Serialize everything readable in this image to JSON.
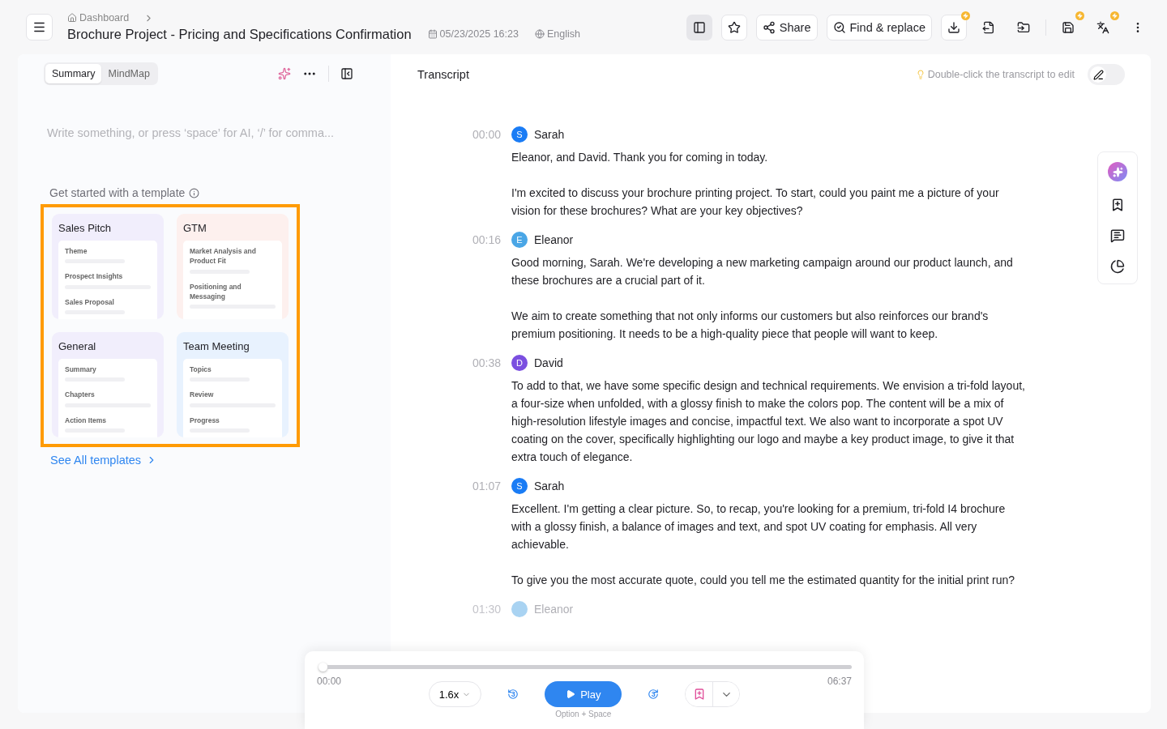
{
  "breadcrumb": "Dashboard",
  "title": "Brochure Project - Pricing and Specifications Confirmation",
  "date": "05/23/2025 16:23",
  "language": "English",
  "toolbar": [
    {
      "kind": "icon",
      "selected": true,
      "boosted": false
    },
    {
      "kind": "icon",
      "selected": false,
      "boosted": false
    },
    {
      "kind": "text",
      "label": "Share",
      "selected": false,
      "boosted": false
    },
    {
      "kind": "text",
      "label": "Find & replace",
      "selected": false,
      "boosted": false
    },
    {
      "kind": "icon",
      "selected": false,
      "boosted": true
    },
    {
      "kind": "plain",
      "selected": false,
      "boosted": false
    },
    {
      "kind": "plain",
      "selected": false,
      "boosted": false
    },
    {
      "kind": "plain",
      "selected": false,
      "boosted": true
    },
    {
      "kind": "plain",
      "selected": false,
      "boosted": true
    },
    {
      "kind": "plain",
      "selected": false,
      "boosted": false
    }
  ],
  "left_panel": {
    "tabs": [
      {
        "label": "Summary",
        "selected": true
      },
      {
        "label": "MindMap",
        "selected": false
      }
    ],
    "editor": {
      "placeholder": "Write something, or press ‘space’ for AI, ‘/’ for comma..."
    },
    "templates_heading": "Get started with a template",
    "templates": [
      {
        "title": "Sales Pitch",
        "color": "#f1eefc",
        "items": [
          "Theme",
          "Prospect Insights",
          "Sales Proposal"
        ]
      },
      {
        "title": "GTM",
        "color": "#fdf0ee",
        "items": [
          "Market Analysis and Product Fit",
          "Positioning and Messaging"
        ]
      },
      {
        "title": "General",
        "color": "#f1eefc",
        "items": [
          "Summary",
          "Chapters",
          "Action Items"
        ]
      },
      {
        "title": "Team Meeting",
        "color": "#e8f2fe",
        "items": [
          "Topics",
          "Review",
          "Progress"
        ]
      }
    ],
    "see_all": "See All templates"
  },
  "transcript": {
    "title": "Transcript",
    "hint": "Double-click the transcript to edit",
    "edit_toggle": {
      "on": false
    },
    "entries": [
      {
        "time": "00:00",
        "initial": "S",
        "speaker": "Sarah",
        "color": "#1a7cf5",
        "faded": false,
        "paragraphs": [
          "Eleanor, and David. Thank you for coming in today.",
          "I'm excited to discuss your brochure printing project. To start, could you paint me a picture of your vision for these brochures? What are your key objectives?"
        ]
      },
      {
        "time": "00:16",
        "initial": "E",
        "speaker": "Eleanor",
        "color": "#4aa6e6",
        "faded": false,
        "paragraphs": [
          "Good morning, Sarah. We're developing a new marketing campaign around our product launch, and these brochures are a crucial part of it.",
          "We aim to create something that not only informs our customers but also reinforces our brand's premium positioning. It needs to be a high-quality piece that people will want to keep."
        ]
      },
      {
        "time": "00:38",
        "initial": "D",
        "speaker": "David",
        "color": "#7b4fe0",
        "faded": false,
        "paragraphs": [
          "To add to that, we have some specific design and technical requirements. We envision a tri-fold layout, a four-size when unfolded, with a glossy finish to make the colors pop. The content will be a mix of high-resolution lifestyle images and concise, impactful text. We also want to incorporate a spot UV coating on the cover, specifically highlighting our logo and maybe a key product image, to give it that extra touch of elegance."
        ]
      },
      {
        "time": "01:07",
        "initial": "S",
        "speaker": "Sarah",
        "color": "#1a7cf5",
        "faded": false,
        "paragraphs": [
          "Excellent. I'm getting a clear picture. So, to recap, you're looking for a premium, tri-fold I4 brochure with a glossy finish, a balance of images and text, and spot UV coating for emphasis. All very achievable.",
          "To give you the most accurate quote, could you tell me the estimated quantity for the initial print run?"
        ]
      },
      {
        "time": "01:30",
        "speaker": "Eleanor",
        "color": "#a9d3f2",
        "faded": true
      }
    ]
  },
  "player": {
    "level": 0,
    "elapsed": "00:00",
    "total": "06:37",
    "speed": "1.6x",
    "back": "3",
    "forward": "3",
    "play": "Play",
    "shortcut": "Option + Space"
  }
}
